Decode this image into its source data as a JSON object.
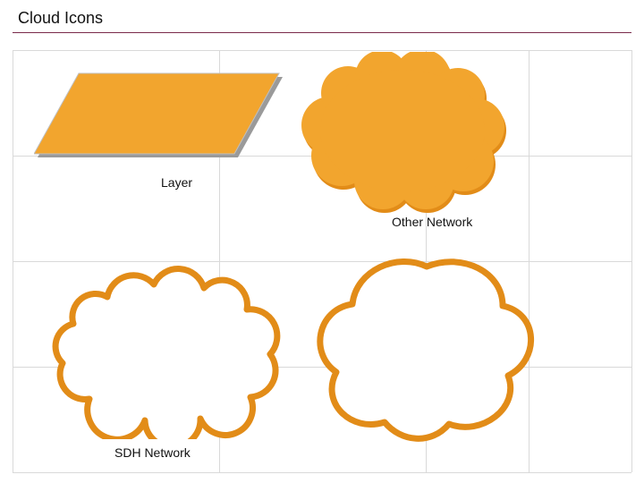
{
  "title": "Cloud Icons",
  "labels": {
    "layer": "Layer",
    "other_network": "Other Network",
    "sdh_network": "SDH Network"
  },
  "colors": {
    "orange": "#f2a52e",
    "orange_edge": "#e28c18",
    "layer_shadow": "#9a9a9a",
    "title_rule": "#7a2a4a",
    "grid": "#d9d9d9"
  }
}
